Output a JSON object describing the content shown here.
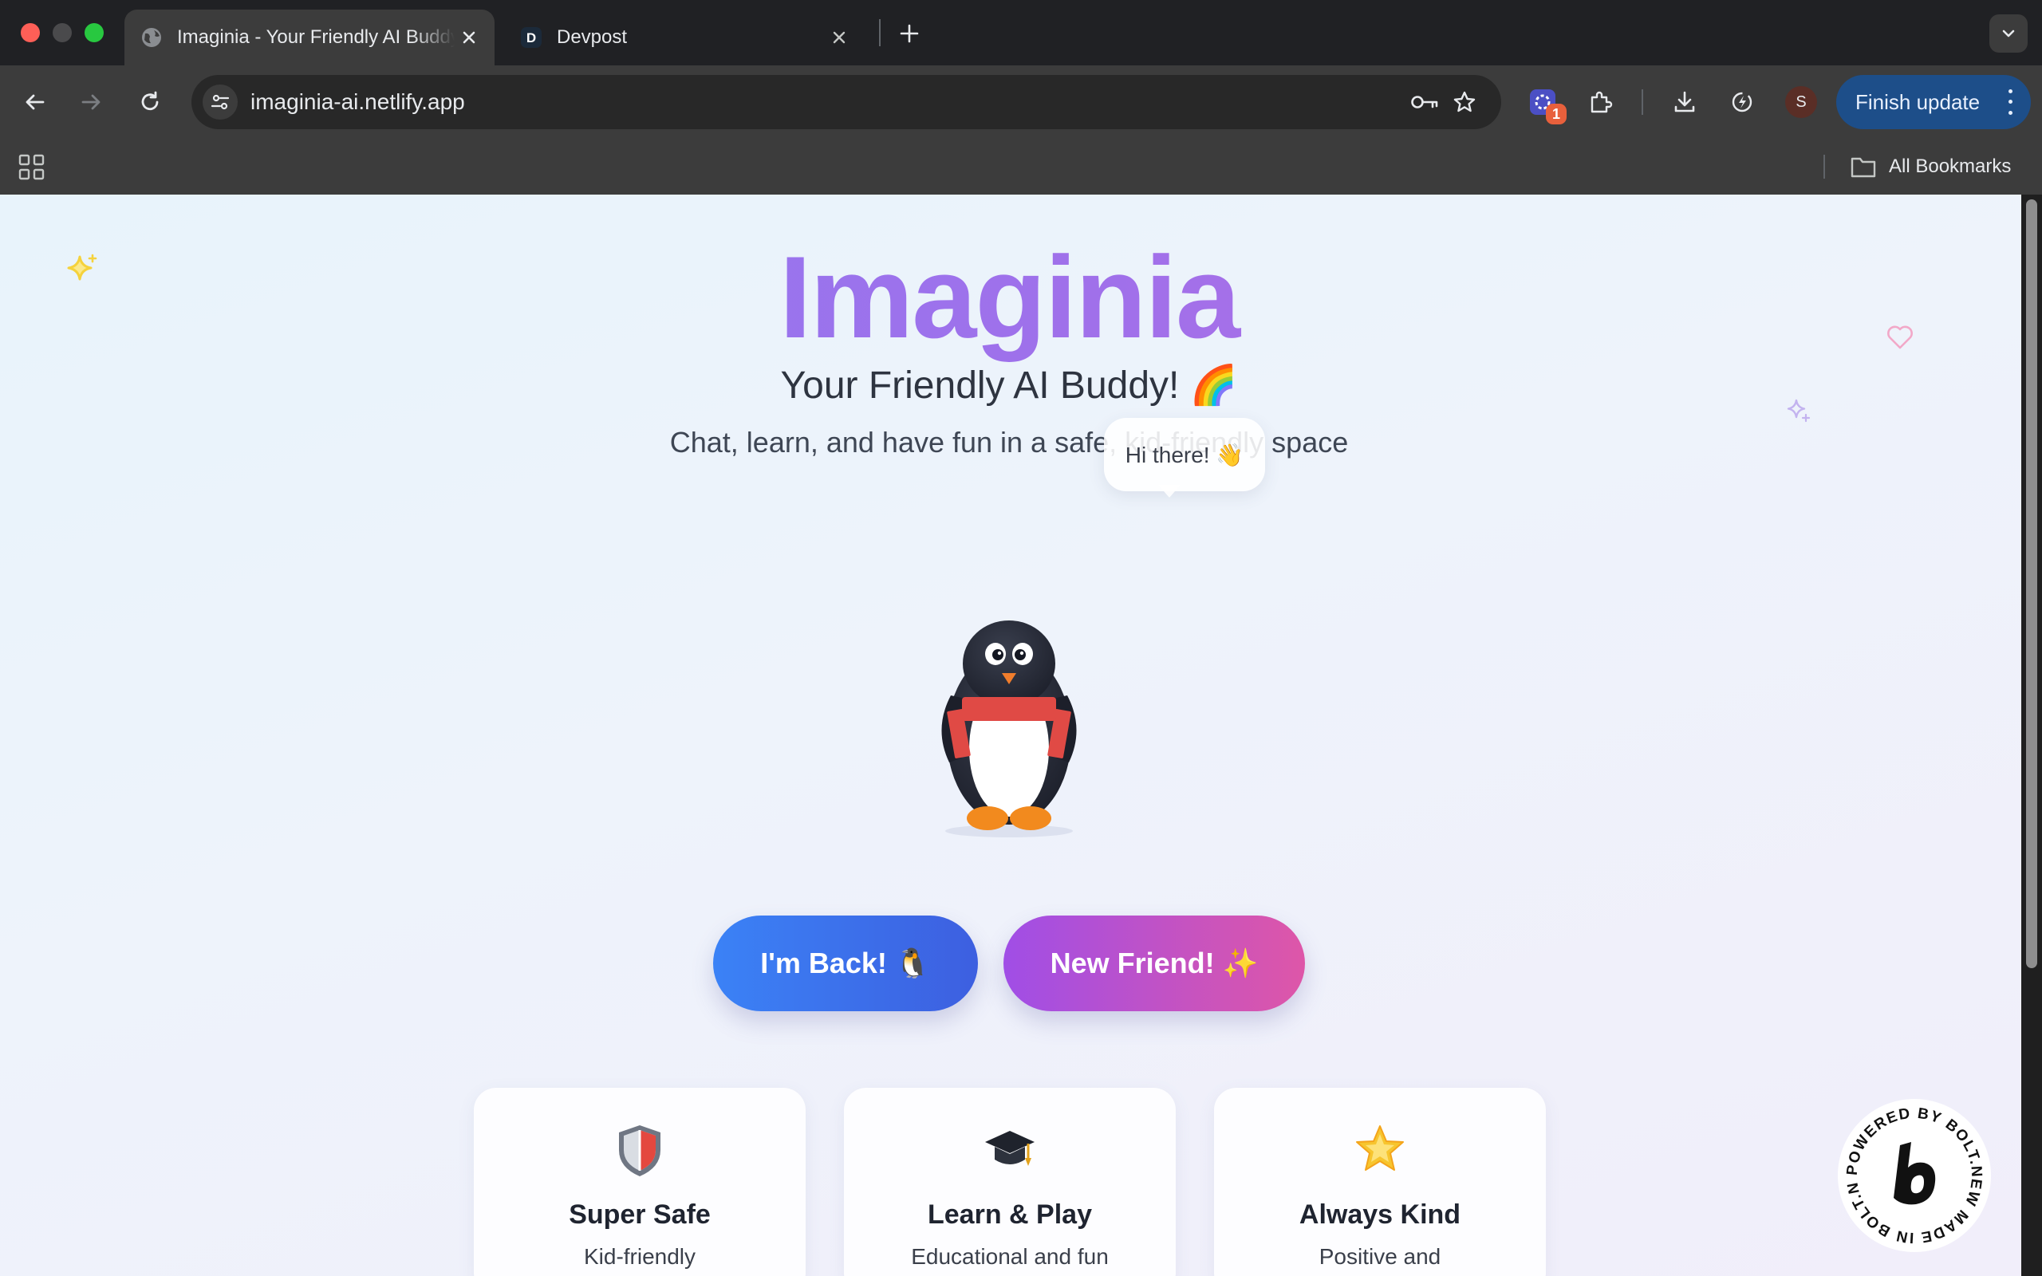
{
  "browser": {
    "tabs": [
      {
        "title": "Imaginia - Your Friendly AI Buddy",
        "active": true
      },
      {
        "title": "Devpost",
        "favicon_letter": "D",
        "active": false
      }
    ],
    "address": {
      "url": "imaginia-ai.netlify.app"
    },
    "extension_badge": "1",
    "profile_initial": "S",
    "finish_update_label": "Finish update",
    "bookmarks": {
      "all_label": "All Bookmarks"
    }
  },
  "page": {
    "title": "Imaginia",
    "subtitle": "Your Friendly AI Buddy! 🌈",
    "tagline": "Chat, learn, and have fun in a safe, kid-friendly space",
    "bubble": "Hi there! 👋",
    "buttons": {
      "back": "I'm Back! 🐧",
      "friend": "New Friend! ✨"
    },
    "features": [
      {
        "icon": "shield-icon",
        "title": "Super Safe",
        "desc": "Kid-friendly"
      },
      {
        "icon": "graduation-cap-icon",
        "title": "Learn & Play",
        "desc": "Educational and fun"
      },
      {
        "icon": "star-icon",
        "title": "Always Kind",
        "desc": "Positive and"
      }
    ],
    "badge_text": "POWERED BY BOLT.NEW MADE IN BOLT.NEW ",
    "colors": {
      "title_gradient_start": "#8b7cf4",
      "title_gradient_end": "#c070e0",
      "back_button": "#3b82f6",
      "friend_button_start": "#a04ee6",
      "friend_button_end": "#de56a8",
      "finish_update": "#1d4e89"
    }
  }
}
